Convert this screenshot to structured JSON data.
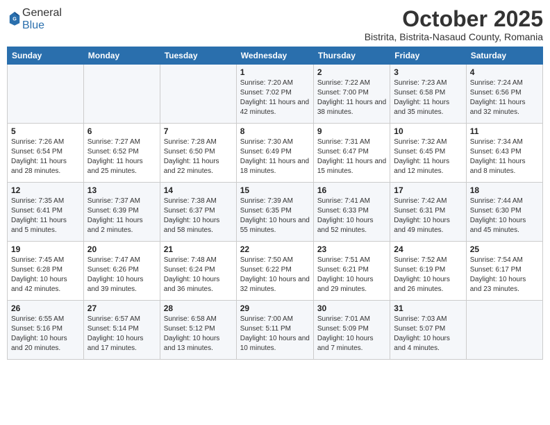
{
  "header": {
    "logo_general": "General",
    "logo_blue": "Blue",
    "title": "October 2025",
    "subtitle": "Bistrita, Bistrita-Nasaud County, Romania"
  },
  "weekdays": [
    "Sunday",
    "Monday",
    "Tuesday",
    "Wednesday",
    "Thursday",
    "Friday",
    "Saturday"
  ],
  "weeks": [
    [
      {
        "day": "",
        "detail": ""
      },
      {
        "day": "",
        "detail": ""
      },
      {
        "day": "",
        "detail": ""
      },
      {
        "day": "1",
        "detail": "Sunrise: 7:20 AM\nSunset: 7:02 PM\nDaylight: 11 hours\nand 42 minutes."
      },
      {
        "day": "2",
        "detail": "Sunrise: 7:22 AM\nSunset: 7:00 PM\nDaylight: 11 hours\nand 38 minutes."
      },
      {
        "day": "3",
        "detail": "Sunrise: 7:23 AM\nSunset: 6:58 PM\nDaylight: 11 hours\nand 35 minutes."
      },
      {
        "day": "4",
        "detail": "Sunrise: 7:24 AM\nSunset: 6:56 PM\nDaylight: 11 hours\nand 32 minutes."
      }
    ],
    [
      {
        "day": "5",
        "detail": "Sunrise: 7:26 AM\nSunset: 6:54 PM\nDaylight: 11 hours\nand 28 minutes."
      },
      {
        "day": "6",
        "detail": "Sunrise: 7:27 AM\nSunset: 6:52 PM\nDaylight: 11 hours\nand 25 minutes."
      },
      {
        "day": "7",
        "detail": "Sunrise: 7:28 AM\nSunset: 6:50 PM\nDaylight: 11 hours\nand 22 minutes."
      },
      {
        "day": "8",
        "detail": "Sunrise: 7:30 AM\nSunset: 6:49 PM\nDaylight: 11 hours\nand 18 minutes."
      },
      {
        "day": "9",
        "detail": "Sunrise: 7:31 AM\nSunset: 6:47 PM\nDaylight: 11 hours\nand 15 minutes."
      },
      {
        "day": "10",
        "detail": "Sunrise: 7:32 AM\nSunset: 6:45 PM\nDaylight: 11 hours\nand 12 minutes."
      },
      {
        "day": "11",
        "detail": "Sunrise: 7:34 AM\nSunset: 6:43 PM\nDaylight: 11 hours\nand 8 minutes."
      }
    ],
    [
      {
        "day": "12",
        "detail": "Sunrise: 7:35 AM\nSunset: 6:41 PM\nDaylight: 11 hours\nand 5 minutes."
      },
      {
        "day": "13",
        "detail": "Sunrise: 7:37 AM\nSunset: 6:39 PM\nDaylight: 11 hours\nand 2 minutes."
      },
      {
        "day": "14",
        "detail": "Sunrise: 7:38 AM\nSunset: 6:37 PM\nDaylight: 10 hours\nand 58 minutes."
      },
      {
        "day": "15",
        "detail": "Sunrise: 7:39 AM\nSunset: 6:35 PM\nDaylight: 10 hours\nand 55 minutes."
      },
      {
        "day": "16",
        "detail": "Sunrise: 7:41 AM\nSunset: 6:33 PM\nDaylight: 10 hours\nand 52 minutes."
      },
      {
        "day": "17",
        "detail": "Sunrise: 7:42 AM\nSunset: 6:31 PM\nDaylight: 10 hours\nand 49 minutes."
      },
      {
        "day": "18",
        "detail": "Sunrise: 7:44 AM\nSunset: 6:30 PM\nDaylight: 10 hours\nand 45 minutes."
      }
    ],
    [
      {
        "day": "19",
        "detail": "Sunrise: 7:45 AM\nSunset: 6:28 PM\nDaylight: 10 hours\nand 42 minutes."
      },
      {
        "day": "20",
        "detail": "Sunrise: 7:47 AM\nSunset: 6:26 PM\nDaylight: 10 hours\nand 39 minutes."
      },
      {
        "day": "21",
        "detail": "Sunrise: 7:48 AM\nSunset: 6:24 PM\nDaylight: 10 hours\nand 36 minutes."
      },
      {
        "day": "22",
        "detail": "Sunrise: 7:50 AM\nSunset: 6:22 PM\nDaylight: 10 hours\nand 32 minutes."
      },
      {
        "day": "23",
        "detail": "Sunrise: 7:51 AM\nSunset: 6:21 PM\nDaylight: 10 hours\nand 29 minutes."
      },
      {
        "day": "24",
        "detail": "Sunrise: 7:52 AM\nSunset: 6:19 PM\nDaylight: 10 hours\nand 26 minutes."
      },
      {
        "day": "25",
        "detail": "Sunrise: 7:54 AM\nSunset: 6:17 PM\nDaylight: 10 hours\nand 23 minutes."
      }
    ],
    [
      {
        "day": "26",
        "detail": "Sunrise: 6:55 AM\nSunset: 5:16 PM\nDaylight: 10 hours\nand 20 minutes."
      },
      {
        "day": "27",
        "detail": "Sunrise: 6:57 AM\nSunset: 5:14 PM\nDaylight: 10 hours\nand 17 minutes."
      },
      {
        "day": "28",
        "detail": "Sunrise: 6:58 AM\nSunset: 5:12 PM\nDaylight: 10 hours\nand 13 minutes."
      },
      {
        "day": "29",
        "detail": "Sunrise: 7:00 AM\nSunset: 5:11 PM\nDaylight: 10 hours\nand 10 minutes."
      },
      {
        "day": "30",
        "detail": "Sunrise: 7:01 AM\nSunset: 5:09 PM\nDaylight: 10 hours\nand 7 minutes."
      },
      {
        "day": "31",
        "detail": "Sunrise: 7:03 AM\nSunset: 5:07 PM\nDaylight: 10 hours\nand 4 minutes."
      },
      {
        "day": "",
        "detail": ""
      }
    ]
  ]
}
